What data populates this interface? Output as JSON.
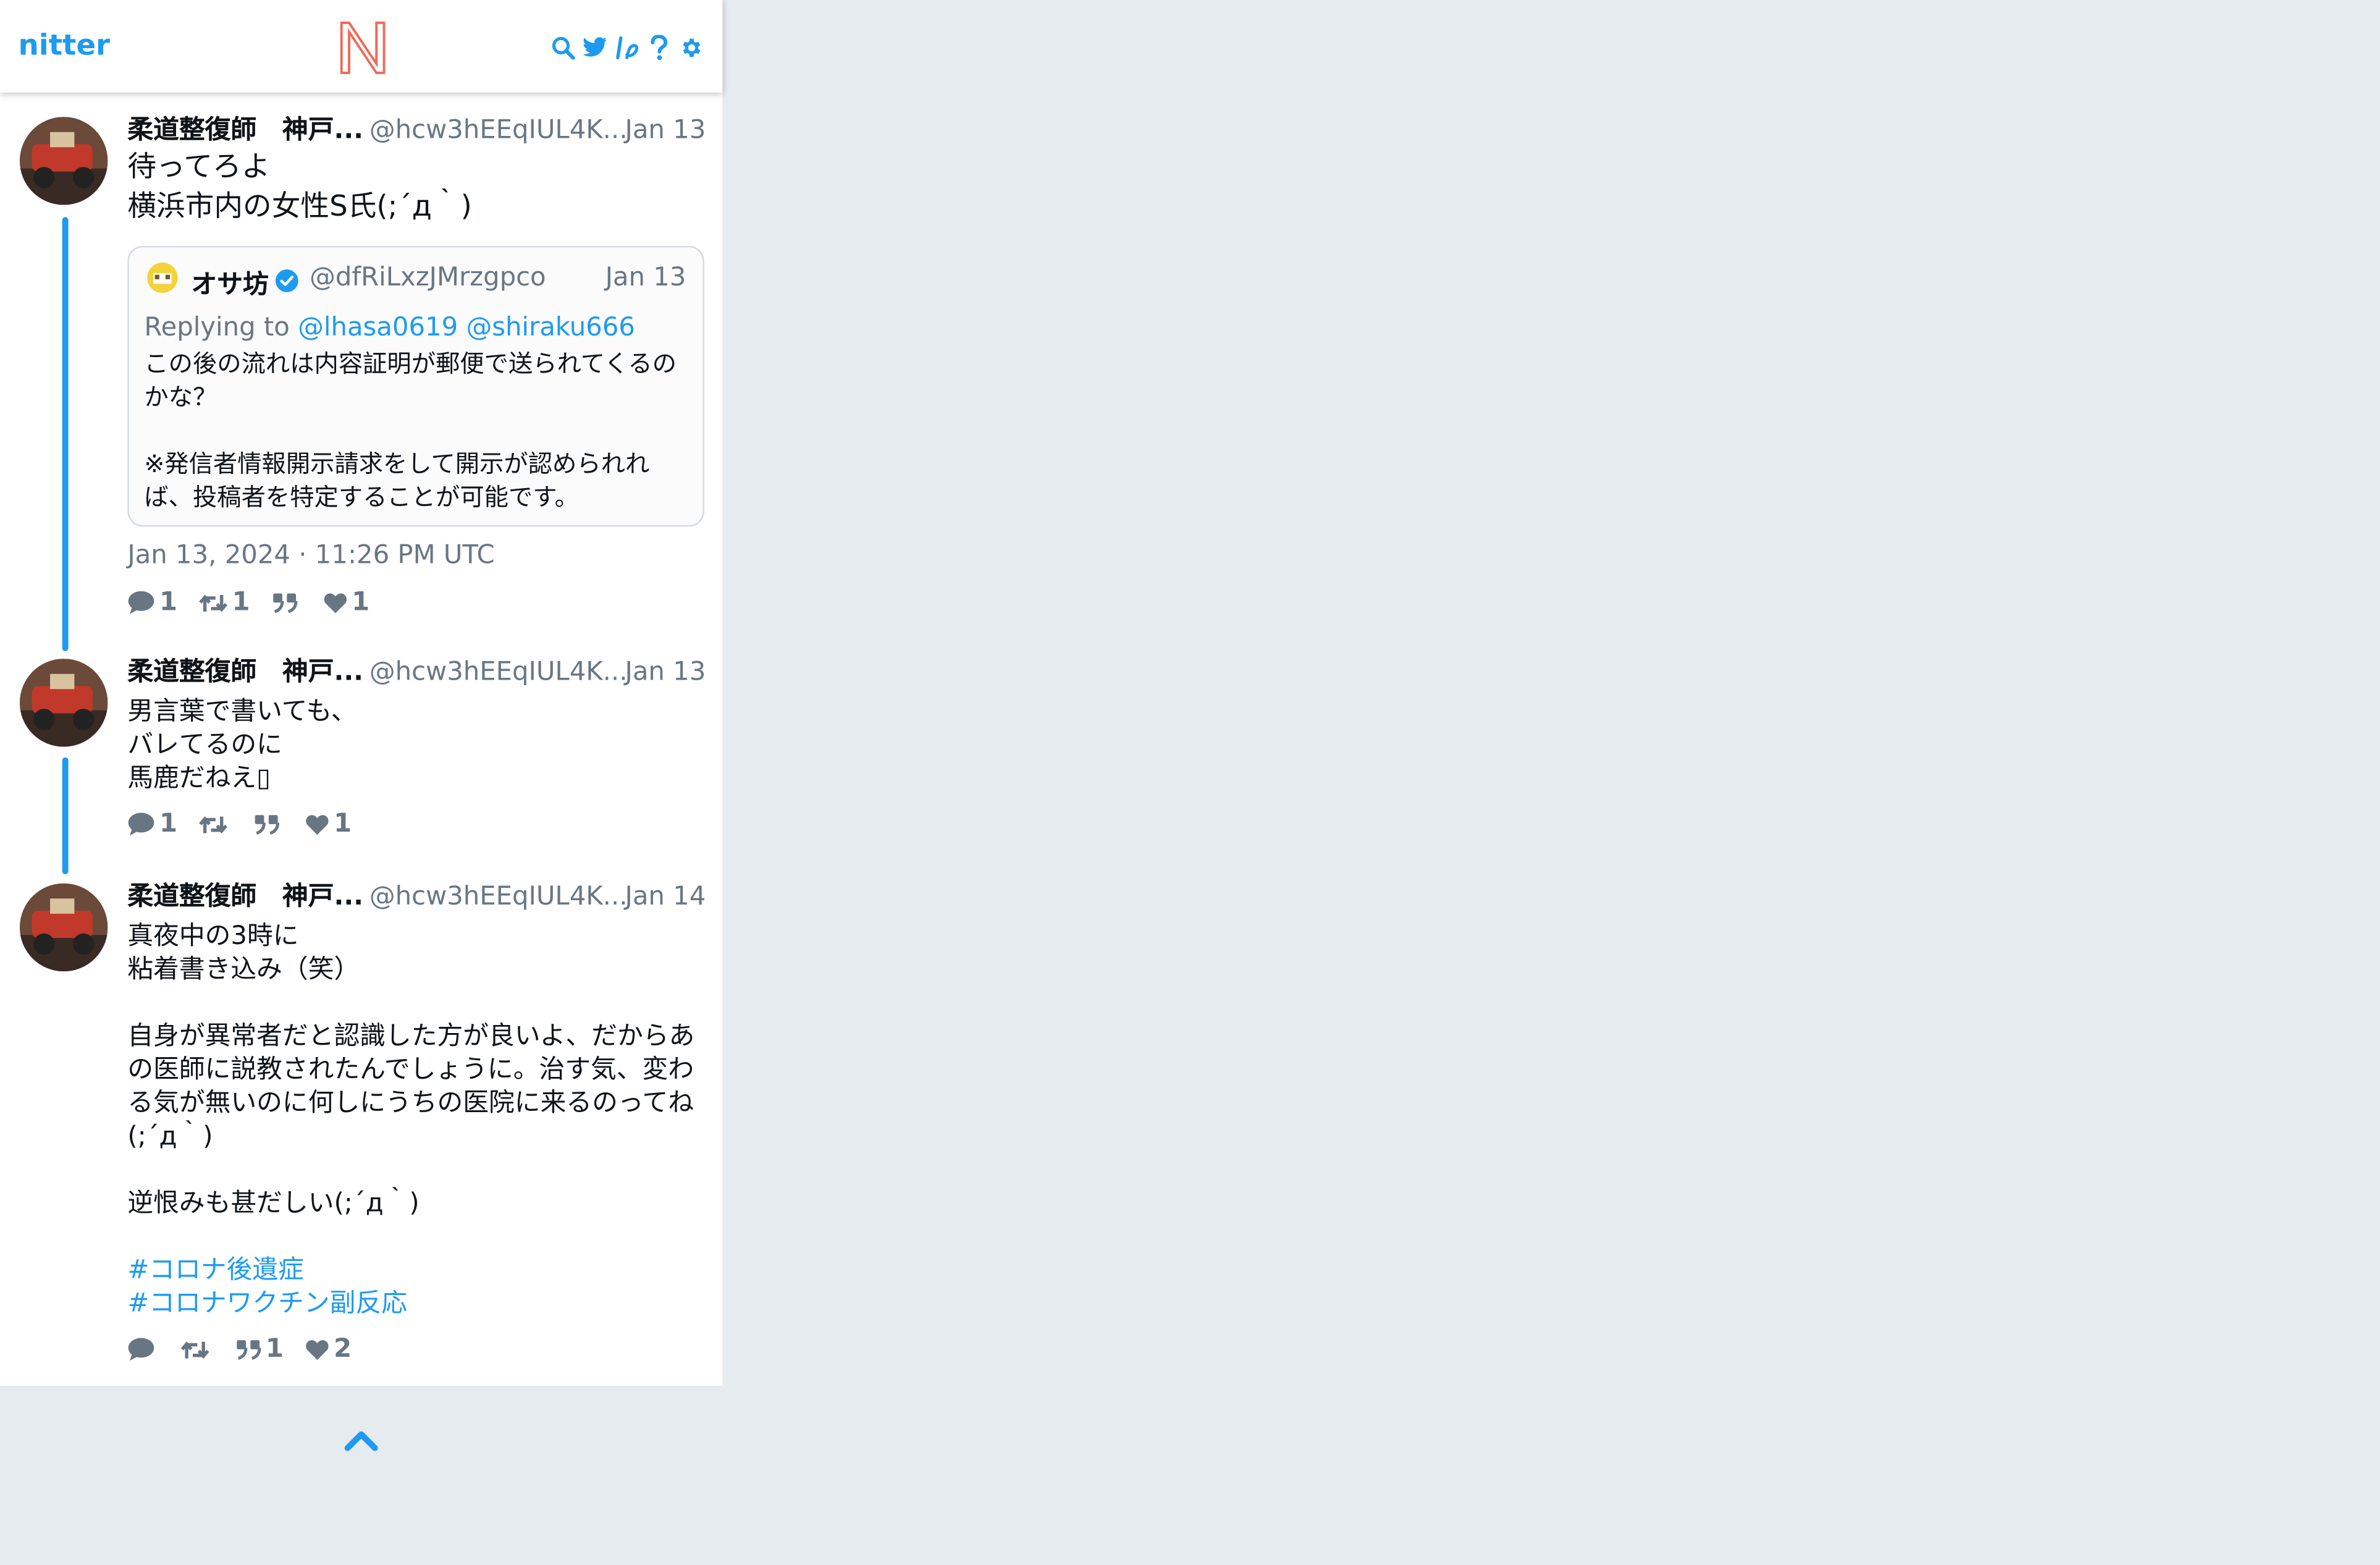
{
  "nav": {
    "brand": "nitter",
    "logo_letter": "N",
    "icons": [
      "search-icon",
      "twitter-icon",
      "rss-icon",
      "help-icon",
      "settings-icon"
    ]
  },
  "colors": {
    "accent": "#1d9bf0",
    "logo": "#ef6a5a",
    "muted": "#687684",
    "page_bg": "#e6ebef"
  },
  "tweets": [
    {
      "fullname": "柔道整復師　神戸...",
      "handle": "@hcw3hEEqIUL4K...",
      "date": "Jan 13",
      "text": "待ってろよ\n横浜市内の女性S氏(;´д｀)",
      "quote": {
        "fullname": "オサ坊",
        "handle": "@dfRiLxzJMrzgpco",
        "date": "Jan 13",
        "replying_label": "Replying to",
        "mentions": [
          "@lhasa0619",
          "@shiraku666"
        ],
        "text": "この後の流れは内容証明が郵便で送られてくるのかな？\n\n※発信者情報開示請求をして開示が認められれば、投稿者を特定することが可能です。"
      },
      "published": "Jan 13, 2024 · 11:26 PM UTC",
      "stats": {
        "replies": "1",
        "retweets": "1",
        "quotes": "",
        "likes": "1"
      }
    },
    {
      "fullname": "柔道整復師　神戸...",
      "handle": "@hcw3hEEqIUL4K...",
      "date": "Jan 13",
      "text": "男言葉で書いても、\nバレてるのに\n馬鹿だねえ▯",
      "stats": {
        "replies": "1",
        "retweets": "",
        "quotes": "",
        "likes": "1"
      }
    },
    {
      "fullname": "柔道整復師　神戸...",
      "handle": "@hcw3hEEqIUL4K...",
      "date": "Jan 14",
      "text": "真夜中の3時に\n粘着書き込み（笑）\n\n自身が異常者だと認識した方が良いよ、だからあの医師に説教されたんでしょうに。治す気、変わる気が無いのに何しにうちの医院に来るのってね(;´д｀)\n\n逆恨みも甚だしい(;´д｀)\n\n",
      "hashtags": [
        "#コロナ後遺症",
        "#コロナワクチン副反応"
      ],
      "stats": {
        "replies": "",
        "retweets": "",
        "quotes": "1",
        "likes": "2"
      }
    }
  ]
}
